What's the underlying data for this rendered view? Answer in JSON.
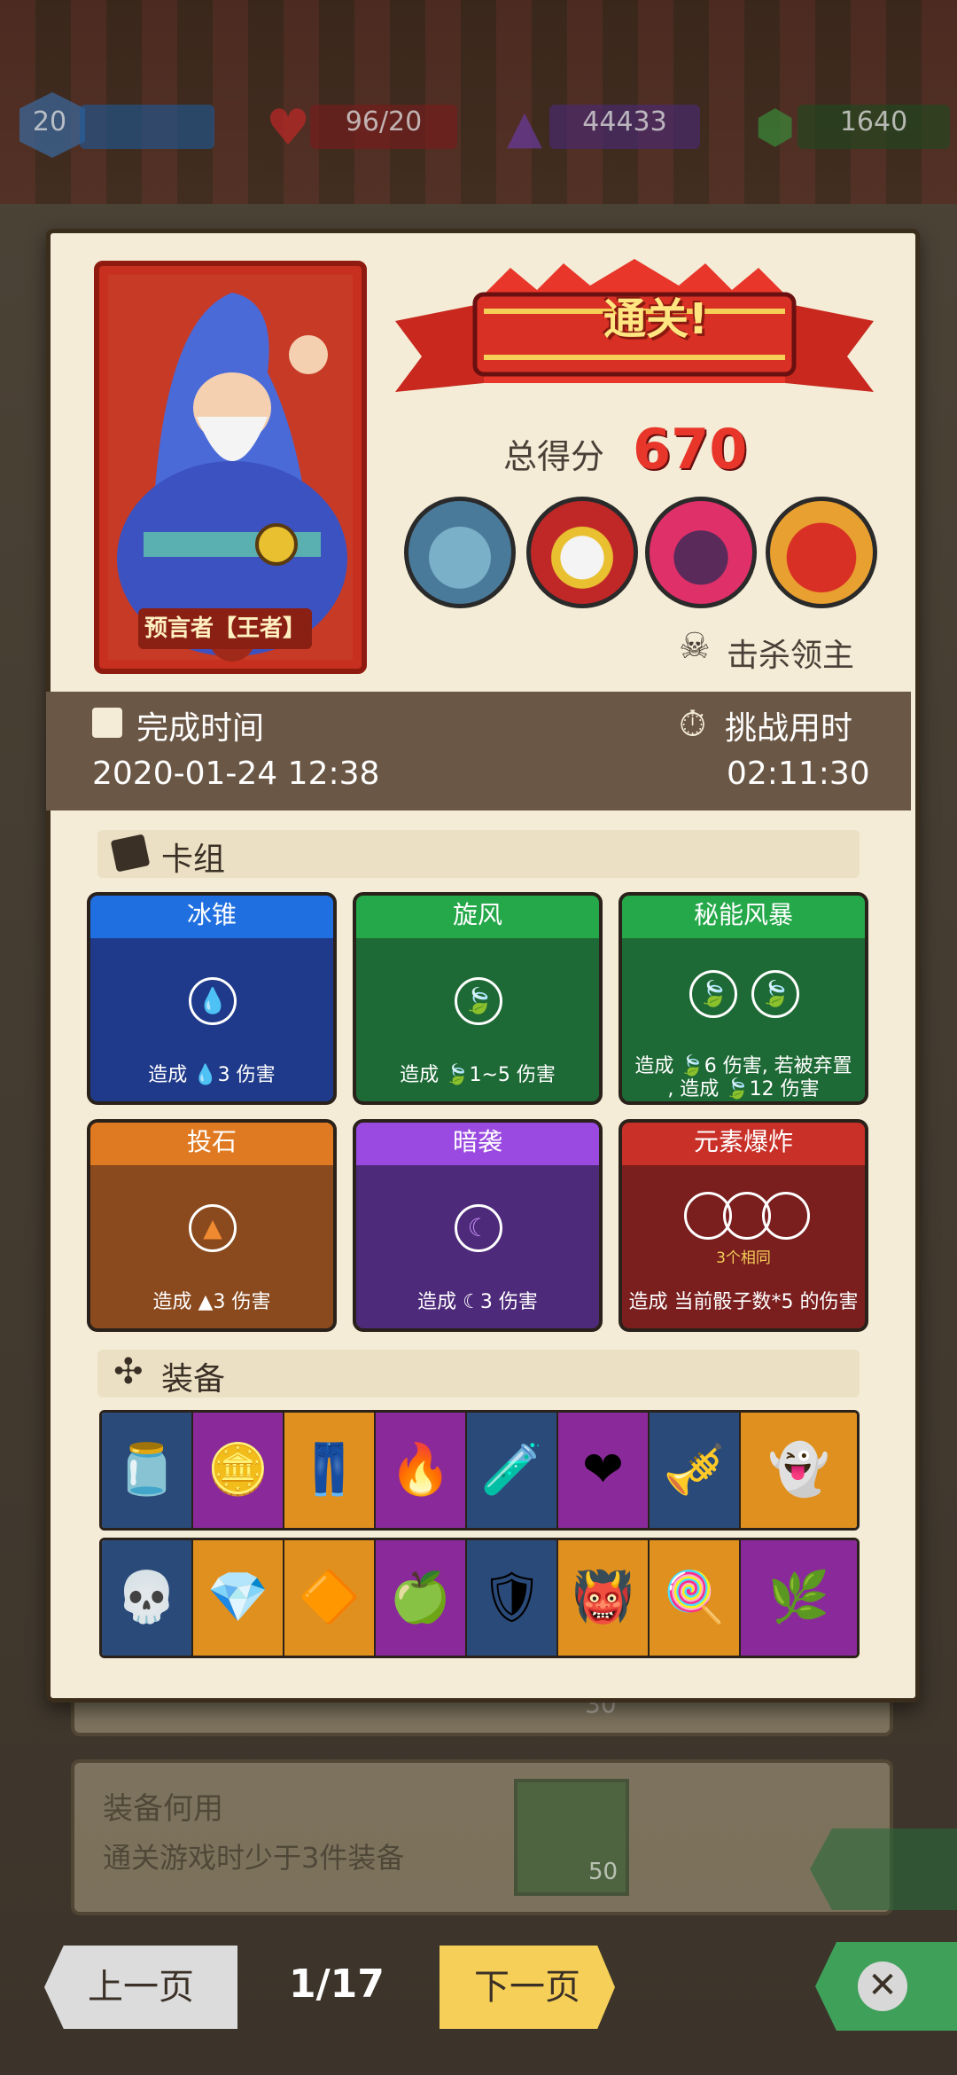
{
  "hud": {
    "level": "20",
    "health": "96/20",
    "crystal": "44433",
    "gem": "1640"
  },
  "result": {
    "banner": "通关!",
    "score_label": "总得分",
    "score_value": "670",
    "hero_label": "预言者【王者】",
    "boss_caption": "击杀领主",
    "bosses": [
      "frog-boss",
      "skull-king-boss",
      "mech-boss",
      "dragon-boss"
    ]
  },
  "info": {
    "finish_label": "完成时间",
    "finish_value": "2020-01-24 12:38",
    "duration_label": "挑战用时",
    "duration_value": "02:11:30"
  },
  "deck": {
    "title": "卡组",
    "cards": [
      {
        "name": "冰锥",
        "desc": "造成 💧3 伤害",
        "color": "#1f3a8a",
        "head": "#1f6fe0"
      },
      {
        "name": "旋风",
        "desc": "造成 🍃1~5 伤害",
        "color": "#1e6a36",
        "head": "#25a84a"
      },
      {
        "name": "秘能风暴",
        "desc_1": "造成 🍃6 伤害, 若被弃置",
        "desc_2": ", 造成 🍃12 伤害",
        "color": "#1e6a36",
        "head": "#25a84a"
      },
      {
        "name": "投石",
        "desc": "造成 ▲3 伤害",
        "color": "#8a4a1e",
        "head": "#e07a22"
      },
      {
        "name": "暗袭",
        "desc": "造成 ☾3 伤害",
        "color": "#4e2a7a",
        "head": "#9a4ae0"
      },
      {
        "name": "元素爆炸",
        "sub": "3个相同",
        "desc": "造成 当前骰子数*5 的伤害",
        "color": "#7a1e1e",
        "head": "#c83028"
      }
    ]
  },
  "equipment": {
    "title": "装备",
    "row1": [
      "jar",
      "coin",
      "pants",
      "fire-shield",
      "cylinder",
      "heart-tag",
      "trumpet",
      "ghost"
    ],
    "row2": [
      "skull-rocket",
      "blue-gem",
      "crystal",
      "green-potion",
      "shield",
      "horned-helmet",
      "swirl-candy",
      "herb"
    ]
  },
  "behind": {
    "achievement_title": "装备何用",
    "achievement_desc": "通关游戏时少于3件装备",
    "achievement_reward": "50",
    "peek_reward": "30"
  },
  "nav": {
    "prev": "上一页",
    "page": "1/17",
    "next": "下一页"
  }
}
